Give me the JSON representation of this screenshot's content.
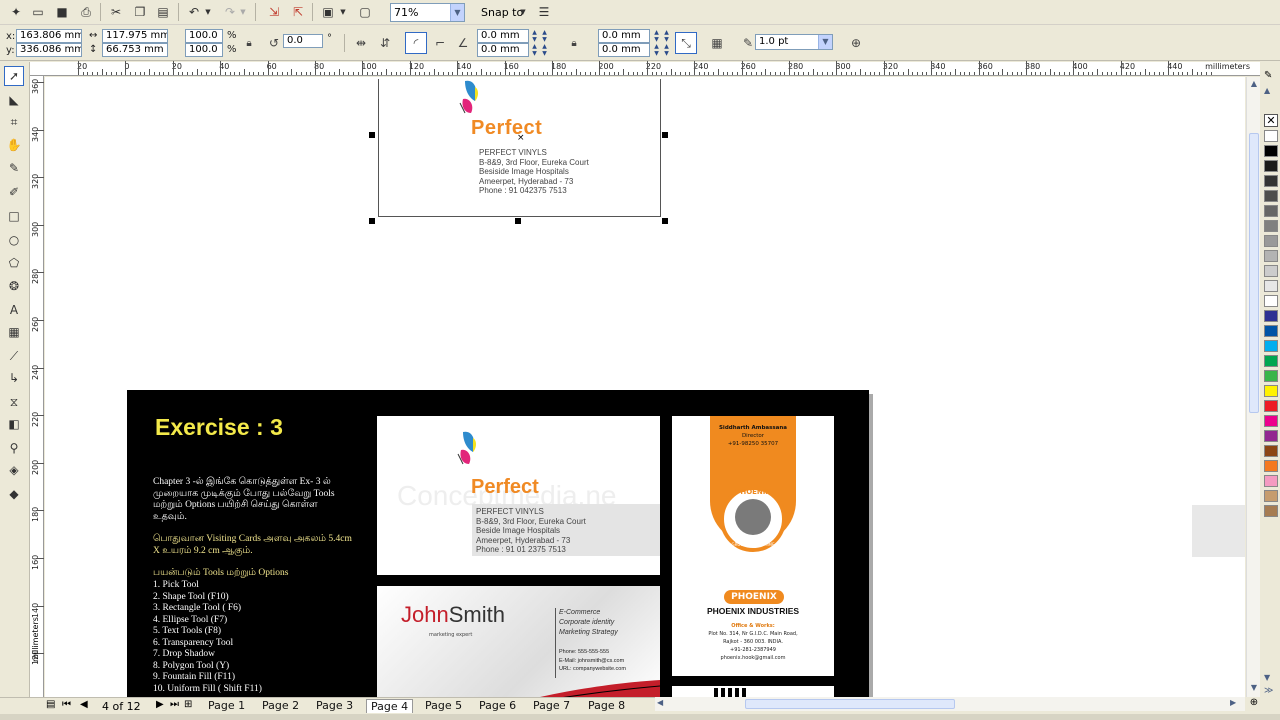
{
  "toolbar": {
    "zoom": "71%",
    "snap_to": "Snap to"
  },
  "property_bar": {
    "x_label": "x:",
    "y_label": "y:",
    "x": "163.806 mm",
    "y": "336.086 mm",
    "width": "117.975 mm",
    "height": "66.753 mm",
    "scale_x": "100.0",
    "scale_y": "100.0",
    "percent": "%",
    "rotation": "0.0",
    "degree": "°",
    "corner1": "0.0 mm",
    "corner2": "0.0 mm",
    "corner3": "0.0 mm",
    "corner4": "0.0 mm",
    "outline_width": "1.0 pt"
  },
  "ruler": {
    "units": "millimeters",
    "h_ticks": [
      "20",
      "0",
      "20",
      "40",
      "60",
      "80",
      "100",
      "120",
      "140",
      "160",
      "180",
      "200",
      "220",
      "240",
      "260",
      "280",
      "300",
      "320",
      "340",
      "360",
      "380",
      "400",
      "420",
      "440"
    ],
    "v_ticks": [
      "360",
      "340",
      "320",
      "300",
      "280",
      "260",
      "240",
      "220",
      "200",
      "180",
      "160",
      "140",
      "120"
    ]
  },
  "selected_card": {
    "logo": "Perfect",
    "lines": [
      "PERFECT VINYLS",
      "B-8&9, 3rd Floor, Eureka Court",
      "Besiside Image Hospitals",
      "Ameerpet, Hyderabad - 73",
      "Phone : 91 042375 7513"
    ]
  },
  "exercise": {
    "title": "Exercise : 3",
    "para1": "Chapter 3 -ல் இங்கே கொடுத்துள்ள Ex- 3 ல் முறையாக முடிக்கும் போது பல்வேறு Tools மற்றும் Options பயிற்சி செய்து கொள்ள உதவும்.",
    "para2": "பொதுவான Visiting Cards அளவு அகலம் 5.4cm X உயரம் 9.2 cm ஆகும்.",
    "tools_heading": "பயன்படும் Tools மற்றும் Options",
    "tools": [
      "1. Pick Tool",
      "2. Shape Tool (F10)",
      "3. Rectangle Tool ( F6)",
      "4. Ellipse Tool (F7)",
      "5. Text Tools (F8)",
      "6. Transparency Tool",
      "7. Drop Shadow",
      "8. Polygon Tool (Y)",
      "9. Fountain Fill (F11)",
      "10. Uniform Fill ( Shift F11)"
    ],
    "card1": {
      "logo": "Perfect",
      "watermark": "Conceptmedia.ne",
      "lines": [
        "PERFECT VINYLS",
        "B-8&9, 3rd Floor, Eureka Court",
        "Beside Image Hospitals",
        "Ameerpet, Hyderabad - 73",
        "Phone : 91 01 2375 7513"
      ]
    },
    "card2": {
      "first": "John",
      "last": "Smith",
      "subtitle": "marketing expert",
      "tags": [
        "E-Commerce",
        "Corporate identity",
        "Marketing Strategy"
      ],
      "phone": "Phone: 555-555-555",
      "email": "E-Mail: johnsmith@cs.com",
      "url": "URL: companywebsite.com"
    },
    "card3": {
      "name": "Siddharth Ambassana",
      "role": "Director",
      "phone": "+91-98250 35707",
      "badge": "PHOENIX",
      "tagline": "GROWING WITH TIME",
      "logo2": "PHOENIX",
      "company": "PHOENIX INDUSTRIES",
      "office": "Office & Works:",
      "addr1": "Plot No. 314, Nr G.I.D.C. Main Road,",
      "addr2": "Rajkot - 360 003. INDIA.",
      "phone2": "+91-281-2387949",
      "email": "phoenix.hook@gmail.com"
    }
  },
  "pages": {
    "counter": "4 of 12",
    "tabs": [
      "Page 1",
      "Page 2",
      "Page 3",
      "Page 4",
      "Page 5",
      "Page 6",
      "Page 7",
      "Page 8"
    ],
    "active": "Page 4"
  },
  "palette_colors": [
    "#ffffff",
    "#000000",
    "#1a1a1a",
    "#333333",
    "#4d4d4d",
    "#666666",
    "#808080",
    "#999999",
    "#b3b3b3",
    "#cccccc",
    "#e6e6e6",
    "#ffffff",
    "#2e3192",
    "#0054a6",
    "#00aeef",
    "#00a651",
    "#39b54a",
    "#fff200",
    "#ed1c24",
    "#ec008c",
    "#92278f",
    "#8b4513",
    "#f47920",
    "#f49ac1",
    "#c69c6d",
    "#a67c52"
  ]
}
